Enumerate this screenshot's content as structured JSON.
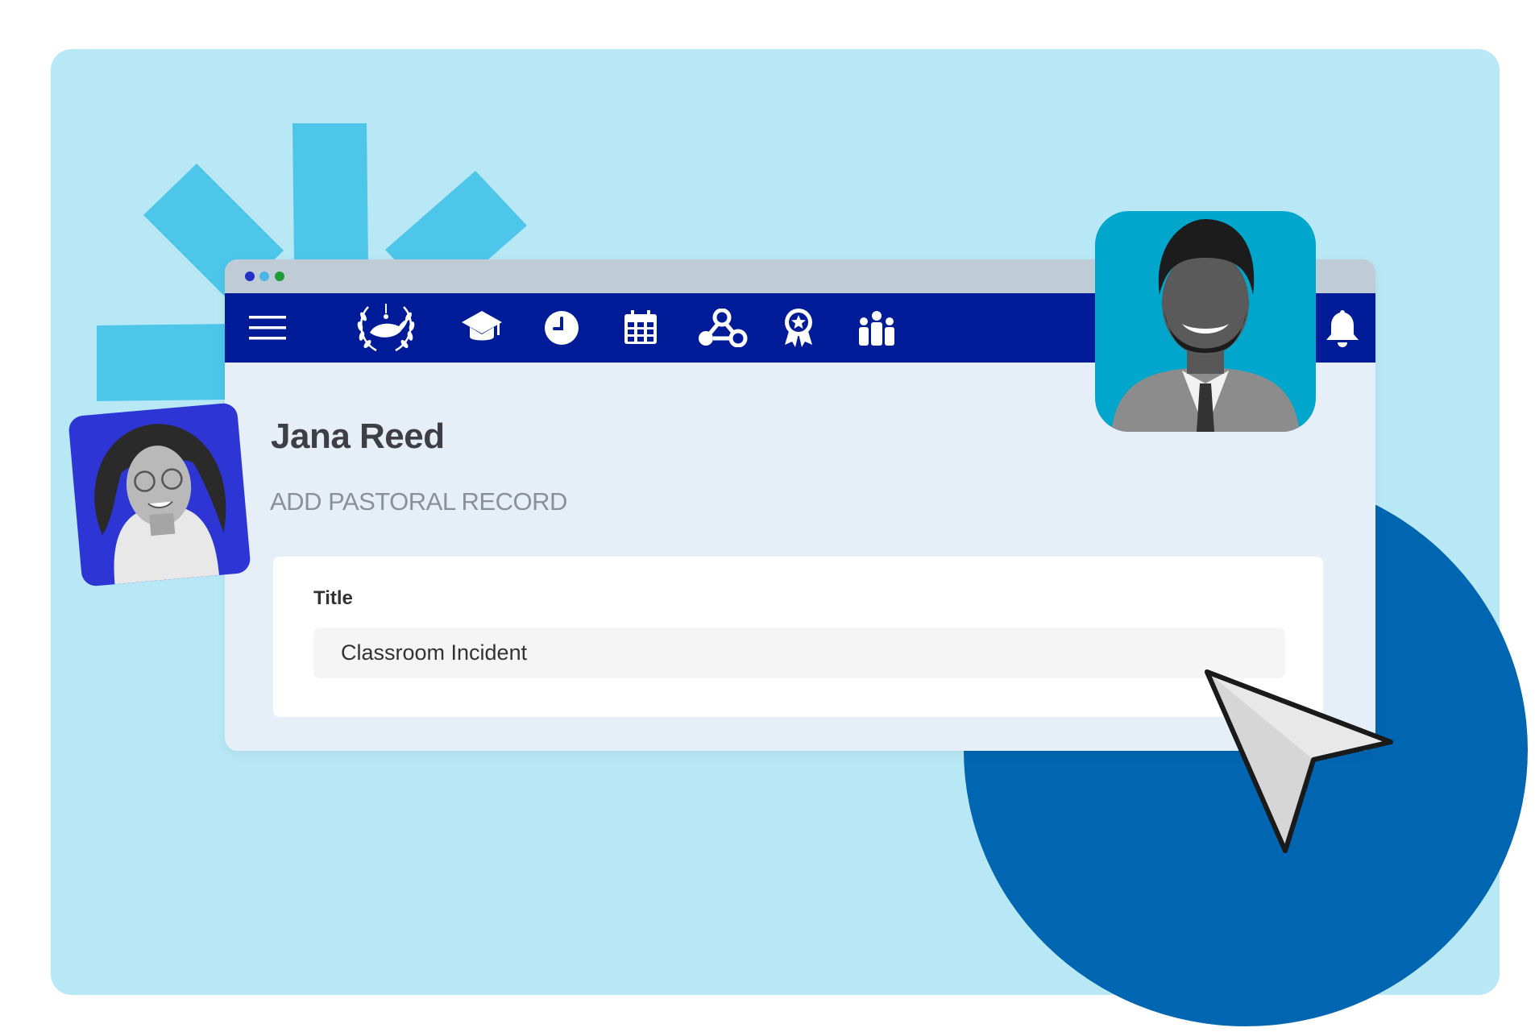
{
  "window": {
    "traffic_lights": [
      "#2230c8",
      "#4ab6e6",
      "#1f9c3a"
    ]
  },
  "navbar": {
    "background": "#001b97",
    "items": [
      {
        "icon": "menu-icon"
      },
      {
        "icon": "school-logo-icon"
      },
      {
        "icon": "graduation-cap-icon"
      },
      {
        "icon": "clock-icon"
      },
      {
        "icon": "calendar-icon"
      },
      {
        "icon": "network-icon"
      },
      {
        "icon": "award-ribbon-icon"
      },
      {
        "icon": "people-icon"
      },
      {
        "icon": "bell-icon"
      }
    ]
  },
  "page": {
    "student_name": "Jana Reed",
    "section_heading": "ADD PASTORAL RECORD"
  },
  "form": {
    "title_label": "Title",
    "title_value": "Classroom Incident"
  },
  "colors": {
    "panel": "#b8e8f5",
    "accent_burst": "#4dc6ea",
    "circle": "#0066b1",
    "avatar_left_bg": "#2d35d4",
    "avatar_right_bg": "#00a6cb"
  }
}
